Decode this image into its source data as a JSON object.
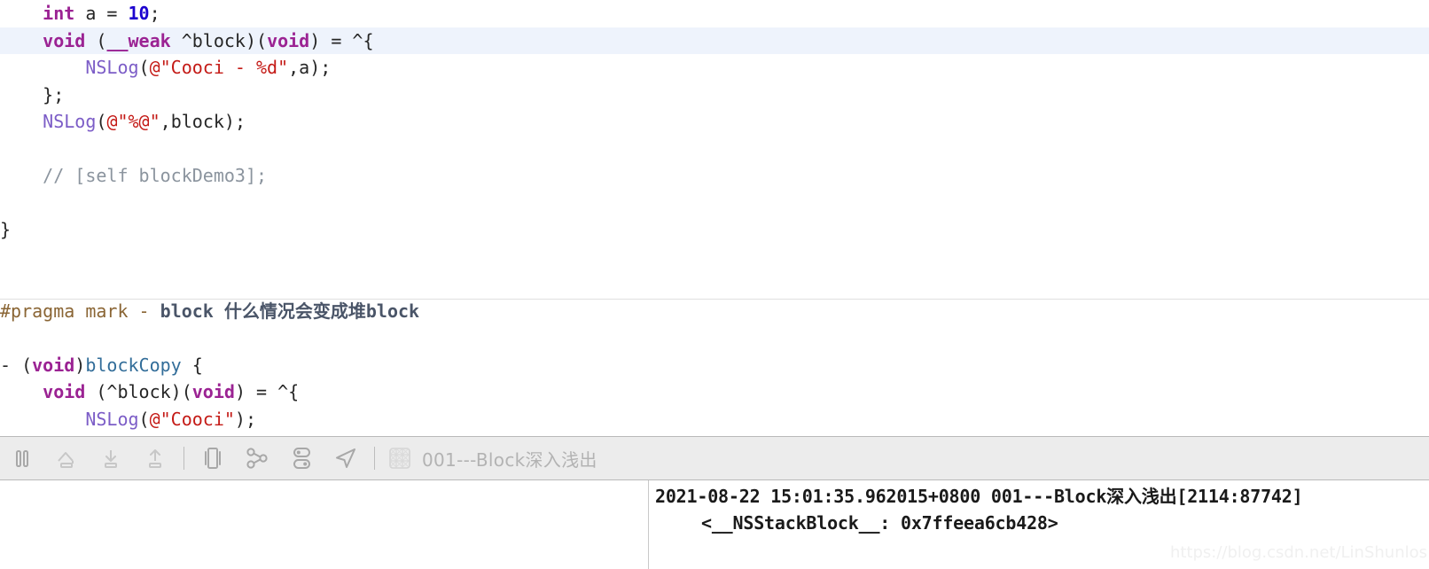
{
  "editor": {
    "lines": [
      {
        "id": "line-int-a",
        "highlighted": false,
        "tokens": [
          {
            "t": "    ",
            "c": "plain"
          },
          {
            "t": "int",
            "c": "kw"
          },
          {
            "t": " a = ",
            "c": "plain"
          },
          {
            "t": "10",
            "c": "num"
          },
          {
            "t": ";",
            "c": "plain"
          }
        ]
      },
      {
        "id": "line-weak-block-decl",
        "highlighted": true,
        "tokens": [
          {
            "t": "    ",
            "c": "plain"
          },
          {
            "t": "void",
            "c": "kw"
          },
          {
            "t": " (",
            "c": "plain"
          },
          {
            "t": "__weak",
            "c": "kw"
          },
          {
            "t": " ^block)(",
            "c": "plain"
          },
          {
            "t": "void",
            "c": "kw"
          },
          {
            "t": ") = ^{",
            "c": "plain"
          }
        ]
      },
      {
        "id": "line-nslog-cooci-d",
        "highlighted": false,
        "tokens": [
          {
            "t": "        ",
            "c": "plain"
          },
          {
            "t": "NSLog",
            "c": "fn"
          },
          {
            "t": "(",
            "c": "plain"
          },
          {
            "t": "@\"Cooci - %d\"",
            "c": "str"
          },
          {
            "t": ",a);",
            "c": "plain"
          }
        ]
      },
      {
        "id": "line-close-brace-semi",
        "highlighted": false,
        "tokens": [
          {
            "t": "    };",
            "c": "plain"
          }
        ]
      },
      {
        "id": "line-nslog-block",
        "highlighted": false,
        "tokens": [
          {
            "t": "    ",
            "c": "plain"
          },
          {
            "t": "NSLog",
            "c": "fn"
          },
          {
            "t": "(",
            "c": "plain"
          },
          {
            "t": "@\"%@\"",
            "c": "str"
          },
          {
            "t": ",block);",
            "c": "plain"
          }
        ]
      },
      {
        "id": "line-blank-1",
        "highlighted": false,
        "tokens": [
          {
            "t": " ",
            "c": "plain"
          }
        ]
      },
      {
        "id": "line-comment-blockdemo3",
        "highlighted": false,
        "tokens": [
          {
            "t": "    // [self blockDemo3];",
            "c": "cmt"
          }
        ]
      },
      {
        "id": "line-blank-2",
        "highlighted": false,
        "tokens": [
          {
            "t": " ",
            "c": "plain"
          }
        ]
      },
      {
        "id": "line-method-end-brace",
        "highlighted": false,
        "tokens": [
          {
            "t": "}",
            "c": "plain"
          }
        ]
      },
      {
        "id": "line-blank-3",
        "highlighted": false,
        "tokens": [
          {
            "t": " ",
            "c": "plain"
          }
        ]
      },
      {
        "id": "line-blank-4",
        "highlighted": false,
        "tokens": [
          {
            "t": " ",
            "c": "plain"
          }
        ]
      },
      {
        "id": "line-pragma-mark",
        "highlighted": false,
        "tokens": [
          {
            "t": "#pragma mark - ",
            "c": "pragma"
          },
          {
            "t": "block 什么情况会变成堆block",
            "c": "pragma-b"
          }
        ]
      },
      {
        "id": "line-blank-5",
        "highlighted": false,
        "tokens": [
          {
            "t": " ",
            "c": "plain"
          }
        ]
      },
      {
        "id": "line-blockcopy-sig",
        "highlighted": false,
        "tokens": [
          {
            "t": "- (",
            "c": "plain"
          },
          {
            "t": "void",
            "c": "kw"
          },
          {
            "t": ")",
            "c": "plain"
          },
          {
            "t": "blockCopy",
            "c": "meth"
          },
          {
            "t": " {",
            "c": "plain"
          }
        ]
      },
      {
        "id": "line-block-decl-2",
        "highlighted": false,
        "tokens": [
          {
            "t": "    ",
            "c": "plain"
          },
          {
            "t": "void",
            "c": "kw"
          },
          {
            "t": " (^block)(",
            "c": "plain"
          },
          {
            "t": "void",
            "c": "kw"
          },
          {
            "t": ") = ^{",
            "c": "plain"
          }
        ]
      },
      {
        "id": "line-nslog-cooci-2",
        "highlighted": false,
        "tokens": [
          {
            "t": "        ",
            "c": "plain"
          },
          {
            "t": "NSLog",
            "c": "fn"
          },
          {
            "t": "(",
            "c": "plain"
          },
          {
            "t": "@\"Cooci\"",
            "c": "str"
          },
          {
            "t": ");",
            "c": "plain"
          }
        ]
      }
    ]
  },
  "debug_bar": {
    "buttons": [
      {
        "name": "pause-button",
        "icon": "pause-icon",
        "label": "Pause program execution"
      },
      {
        "name": "step-over-button",
        "icon": "step-over-icon",
        "label": "Step over"
      },
      {
        "name": "step-into-button",
        "icon": "step-into-icon",
        "label": "Step into"
      },
      {
        "name": "step-out-button",
        "icon": "step-out-icon",
        "label": "Step out"
      },
      {
        "name": "view-debugging-button",
        "icon": "view-debug-icon",
        "label": "Debug View Hierarchy"
      },
      {
        "name": "memory-graph-button",
        "icon": "memory-graph-icon",
        "label": "Debug Memory Graph"
      },
      {
        "name": "environment-overrides-button",
        "icon": "environment-overrides-icon",
        "label": "Environment Overrides"
      },
      {
        "name": "simulate-location-button",
        "icon": "location-arrow-icon",
        "label": "Simulate Location"
      }
    ],
    "breadcrumb": {
      "icon": "thread-grid-icon",
      "text": "001---Block深入浅出"
    }
  },
  "console": {
    "line1": "2021-08-22 15:01:35.962015+0800 001---Block深入浅出[2114:87742]",
    "line2": "<__NSStackBlock__: 0x7ffeea6cb428>"
  },
  "watermark": {
    "text": "https://blog.csdn.net/LinShunlos"
  },
  "colors": {
    "keyword": "#9b2393",
    "number": "#1c00cf",
    "string": "#c41a16",
    "comment": "#8b949e",
    "function": "#7c5dc7",
    "method": "#326d99",
    "pragma": "#8a6534",
    "highlight_bg": "#eef3fc",
    "toolbar_bg": "#ececec",
    "breadcrumb_text": "#b3b3b3"
  }
}
